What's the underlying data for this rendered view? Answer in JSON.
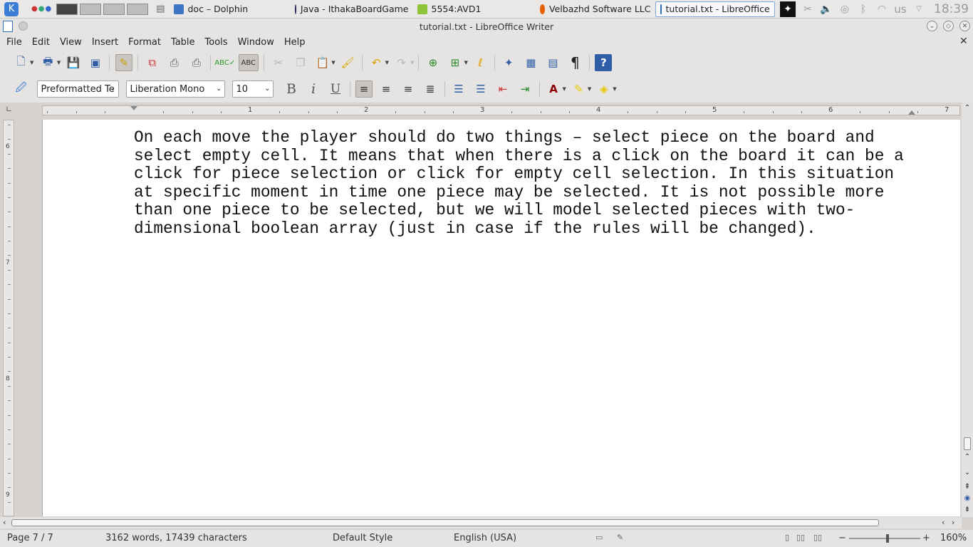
{
  "taskbar": {
    "items": [
      {
        "label": "doc – Dolphin",
        "icon": "dolphin-folder-icon",
        "color": "#3d75c4"
      },
      {
        "label": "Java - IthakaBoardGame",
        "icon": "eclipse-icon",
        "color": "#2c2255"
      },
      {
        "label": "5554:AVD1",
        "icon": "android-icon",
        "color": "#8fc43a"
      },
      {
        "label": "Velbazhd Software LLC",
        "icon": "firefox-icon",
        "color": "#e66000"
      },
      {
        "label": "tutorial.txt - LibreOffice",
        "icon": "writer-document-icon",
        "color": "#2f6db5",
        "active": true
      }
    ],
    "keyboard_layout": "us",
    "clock": "18:39"
  },
  "window": {
    "title": "tutorial.txt - LibreOffice Writer"
  },
  "menu": [
    "File",
    "Edit",
    "View",
    "Insert",
    "Format",
    "Table",
    "Tools",
    "Window",
    "Help"
  ],
  "formatting": {
    "paragraph_style": "Preformatted Te",
    "font_name": "Liberation Mono",
    "font_size": "10"
  },
  "ruler": {
    "h_numbers": [
      "1",
      "2",
      "3",
      "4",
      "5",
      "6",
      "7"
    ],
    "v_numbers": [
      "6",
      "7",
      "8",
      "9"
    ]
  },
  "document": {
    "text": "On each move the player should do two things – select piece on the board and\nselect empty cell. It means that when there is a click on the board it can be a\nclick for piece selection or click for empty cell selection. In this situation\nat specific moment in time one piece may be selected. It is not possible more\nthan one piece to be selected, but we will model selected pieces with two-\ndimensional boolean array (just in case if the rules will be changed)."
  },
  "status": {
    "page": "Page 7 / 7",
    "word_count": "3162 words, 17439 characters",
    "style": "Default Style",
    "language": "English (USA)",
    "zoom": "160%"
  }
}
